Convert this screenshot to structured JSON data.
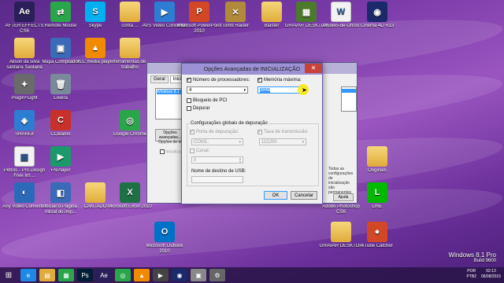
{
  "desktop": {
    "icons": [
      {
        "label": "AFTER EFFECTS CS6",
        "type": "app",
        "glyph": "Ae",
        "color": "#2a1f5a"
      },
      {
        "label": "Remote Mouse",
        "type": "app",
        "glyph": "⇄",
        "color": "#2aa64a"
      },
      {
        "label": "Skype",
        "type": "app",
        "glyph": "S",
        "color": "#00aff0"
      },
      {
        "label": "conta ...",
        "type": "folder",
        "glyph": "",
        "color": ""
      },
      {
        "label": "AVS Video Converter",
        "type": "app",
        "glyph": "▶",
        "color": "#2d7dd2"
      },
      {
        "label": "Microsoft PowerPoint 2010",
        "type": "app",
        "glyph": "P",
        "color": "#d24726"
      },
      {
        "label": "Tomb Raider",
        "type": "app",
        "glyph": "✕",
        "color": "#b08a3a"
      },
      {
        "label": "Blaster",
        "type": "folder",
        "glyph": "",
        "color": ""
      },
      {
        "label": "GRAVAR DESKTOP",
        "type": "app",
        "glyph": "▦",
        "color": "#4a7a2a"
      },
      {
        "label": "Modelo-de-Ofício",
        "type": "file",
        "glyph": "W",
        "color": ""
      },
      {
        "label": "Cinema 4D R13",
        "type": "app",
        "glyph": "◉",
        "color": "#1a2a6a"
      },
      {
        "label": "Alison da silva santana Santana",
        "type": "folder",
        "glyph": "",
        "color": ""
      },
      {
        "label": "Mapa Compilador",
        "type": "app",
        "glyph": "▣",
        "color": "#3a6ab8"
      },
      {
        "label": "VLC media player",
        "type": "app",
        "glyph": "▲",
        "color": "#f08a00"
      },
      {
        "label": "ferramentas de trabalho",
        "type": "folder",
        "glyph": "",
        "color": ""
      },
      {
        "label": "Plugin+Light",
        "type": "app",
        "glyph": "✦",
        "color": "#6a6a6a"
      },
      {
        "label": "Lixeira",
        "type": "app",
        "glyph": "🗑",
        "color": "#7a8a9a"
      },
      {
        "label": "SHAREit",
        "type": "app",
        "glyph": "◈",
        "color": "#2d7dd2"
      },
      {
        "label": "CCleaner",
        "type": "app",
        "glyph": "C",
        "color": "#c8302a"
      },
      {
        "label": "Google Chrome",
        "type": "app",
        "glyph": "◎",
        "color": "#2aa64a"
      },
      {
        "label": "Petros - Pro Design Free Int ...",
        "type": "file",
        "glyph": "▤",
        "color": ""
      },
      {
        "label": "FNPlayer",
        "type": "app",
        "glyph": "▶",
        "color": "#1a9a6a"
      },
      {
        "label": "Any Video Converter",
        "type": "app",
        "glyph": "◐",
        "color": "#2a6ab8"
      },
      {
        "label": "Iniciar o Página inicial do imp...",
        "type": "app",
        "glyph": "◧",
        "color": "#3a6ab8"
      },
      {
        "label": "CANTADO",
        "type": "folder",
        "glyph": "",
        "color": ""
      },
      {
        "label": "Microsoft Excel 2010",
        "type": "app",
        "glyph": "X",
        "color": "#1e7145"
      },
      {
        "label": "Adobe Photoshop CS6",
        "type": "app",
        "glyph": "Ps",
        "color": "#001e36"
      },
      {
        "label": "LINE",
        "type": "app",
        "glyph": "L",
        "color": "#00b900"
      },
      {
        "label": "Originals",
        "type": "folder",
        "glyph": "",
        "color": ""
      },
      {
        "label": "Microsoft Outlook 2010",
        "type": "app",
        "glyph": "O",
        "color": "#0072c6"
      },
      {
        "label": "GRAVAR DESKTOP",
        "type": "folder",
        "glyph": "",
        "color": ""
      },
      {
        "label": "eTube Catcher",
        "type": "app",
        "glyph": "●",
        "color": "#d24726"
      }
    ]
  },
  "background_window": {
    "tabs": [
      "Geral",
      "Inicial",
      "Serviços",
      "Inicializar",
      "Ferramentas"
    ],
    "list_item": "Windows 8.1",
    "advanced_button": "Opções avançadas...",
    "boot_options_label": "Opções de inicialização",
    "safe_boot_label": "Inicialização segura",
    "right_text": "Todas as configurações de inicialização são permanentes",
    "help_button": "Ajuda"
  },
  "dialog": {
    "title": "Opções Avançadas de INICIALIZAÇÃO",
    "close_glyph": "✕",
    "num_processors_label": "Número de processadores:",
    "num_processors_value": "4",
    "max_memory_label": "Memória máxima:",
    "max_memory_value": "3948",
    "pci_lock_label": "Bloqueio de PCI",
    "debug_label": "Depurar",
    "global_debug_group": "Configurações globais de depuração",
    "debug_port_label": "Porta de depuração:",
    "debug_port_value": "COM1:",
    "baud_rate_label": "Taxa de transmissão:",
    "baud_rate_value": "115200",
    "channel_label": "Canal:",
    "channel_value": "0",
    "usb_target_label": "Nome de destino de USB:",
    "ok_button": "OK",
    "cancel_button": "Cancelar"
  },
  "taskbar": {
    "start_glyph": "⊞",
    "buttons": [
      {
        "name": "internet-explorer",
        "glyph": "e",
        "color": "#1e88e5"
      },
      {
        "name": "file-explorer",
        "glyph": "▤",
        "color": "#e0ab3a"
      },
      {
        "name": "store",
        "glyph": "▦",
        "color": "#2aa64a"
      },
      {
        "name": "photoshop",
        "glyph": "Ps",
        "color": "#001e36"
      },
      {
        "name": "after-effects",
        "glyph": "Ae",
        "color": "#2a1f5a"
      },
      {
        "name": "chrome",
        "glyph": "◎",
        "color": "#2aa64a"
      },
      {
        "name": "vlc",
        "glyph": "▲",
        "color": "#f08a00"
      },
      {
        "name": "media",
        "glyph": "▶",
        "color": "#444"
      },
      {
        "name": "cinema4d",
        "glyph": "◉",
        "color": "#1a2a6a"
      },
      {
        "name": "notes",
        "glyph": "▣",
        "color": "#888"
      },
      {
        "name": "settings",
        "glyph": "⚙",
        "color": "#666"
      }
    ],
    "language": "POR",
    "language_sub": "PTB2",
    "time": "02:13",
    "date": "06/08/2015"
  },
  "windows_version": {
    "line1": "Windows 8.1 Pro",
    "line2": "Build 9600"
  }
}
